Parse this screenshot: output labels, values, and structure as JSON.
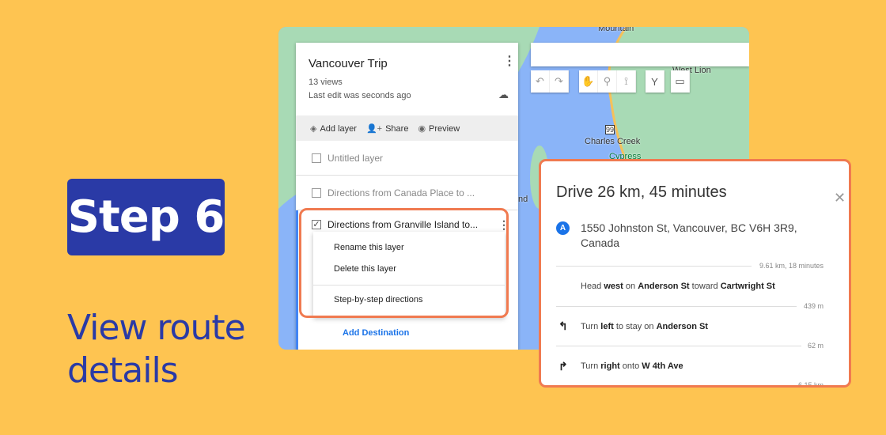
{
  "step": {
    "label": "Step 6"
  },
  "caption": "View route details",
  "colors": {
    "background": "#FEC451",
    "accent": "#2A3AA6",
    "highlight": "#F07A50",
    "link": "#1A73E8"
  },
  "map": {
    "labels": [
      "Mountain",
      "West Lion",
      "99",
      "Charles Creek",
      "Cypress",
      "nd"
    ],
    "tools": [
      "undo-icon",
      "redo-icon",
      "hand-icon",
      "marker-icon",
      "line-icon",
      "directions-icon",
      "ruler-icon"
    ]
  },
  "panel": {
    "title": "Vancouver Trip",
    "views": "13 views",
    "last_edit": "Last edit was seconds ago",
    "actions": {
      "add_layer": "Add layer",
      "share": "Share",
      "preview": "Preview"
    },
    "layers": [
      {
        "name": "Untitled layer",
        "checked": false
      },
      {
        "name": "Directions from Canada Place to ...",
        "checked": false
      },
      {
        "name": "Directions from Granville Island to...",
        "checked": true
      }
    ],
    "menu": [
      "Rename this layer",
      "Delete this layer",
      "Step-by-step directions"
    ],
    "add_destination": "Add Destination"
  },
  "directions": {
    "title": "Drive 26 km, 45 minutes",
    "origin_marker": "A",
    "origin": "1550 Johnston St, Vancouver, BC V6H 3R9, Canada",
    "segment": "9.61 km, 18 minutes",
    "steps": [
      {
        "pre": "Head ",
        "b1": "west",
        "mid": " on ",
        "b2": "Anderson St",
        "post": " toward ",
        "b3": "Cartwright St",
        "dist": "439 m"
      },
      {
        "pre": "Turn ",
        "b1": "left",
        "mid": " to stay on ",
        "b2": "Anderson St",
        "post": "",
        "b3": "",
        "dist": "62 m"
      },
      {
        "pre": "Turn ",
        "b1": "right",
        "mid": " onto ",
        "b2": "W 4th Ave",
        "post": "",
        "b3": "",
        "dist": "6.15 km"
      }
    ]
  }
}
